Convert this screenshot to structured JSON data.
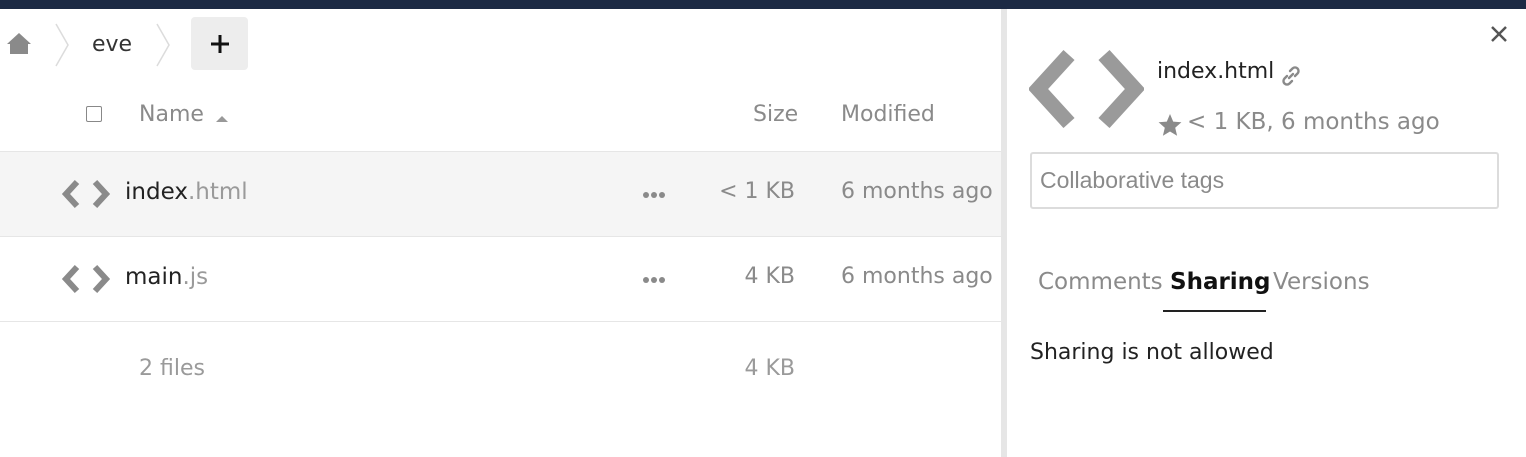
{
  "breadcrumb": {
    "folder": "eve",
    "add_label": "+"
  },
  "table": {
    "headers": {
      "name": "Name",
      "size": "Size",
      "modified": "Modified"
    },
    "rows": [
      {
        "base": "index",
        "ext": ".html",
        "size": "< 1 KB",
        "modified": "6 months ago",
        "selected": true
      },
      {
        "base": "main",
        "ext": ".js",
        "size": "4 KB",
        "modified": "6 months ago",
        "selected": false
      }
    ],
    "summary": {
      "count": "2 files",
      "size": "4 KB"
    }
  },
  "details": {
    "filename": "index.html",
    "meta": "< 1 KB, 6 months ago",
    "tags_placeholder": "Collaborative tags",
    "tabs": [
      "Comments",
      "Sharing",
      "Versions"
    ],
    "active_tab": "Sharing",
    "message": "Sharing is not allowed"
  },
  "colors": {
    "topbar": "#1c2a44",
    "selected_row": "#f5f5f5",
    "icon_gray": "#8a8a8a"
  },
  "icons": [
    "home-icon",
    "code-file-icon",
    "more-icon",
    "link-icon",
    "star-icon",
    "close-icon"
  ]
}
